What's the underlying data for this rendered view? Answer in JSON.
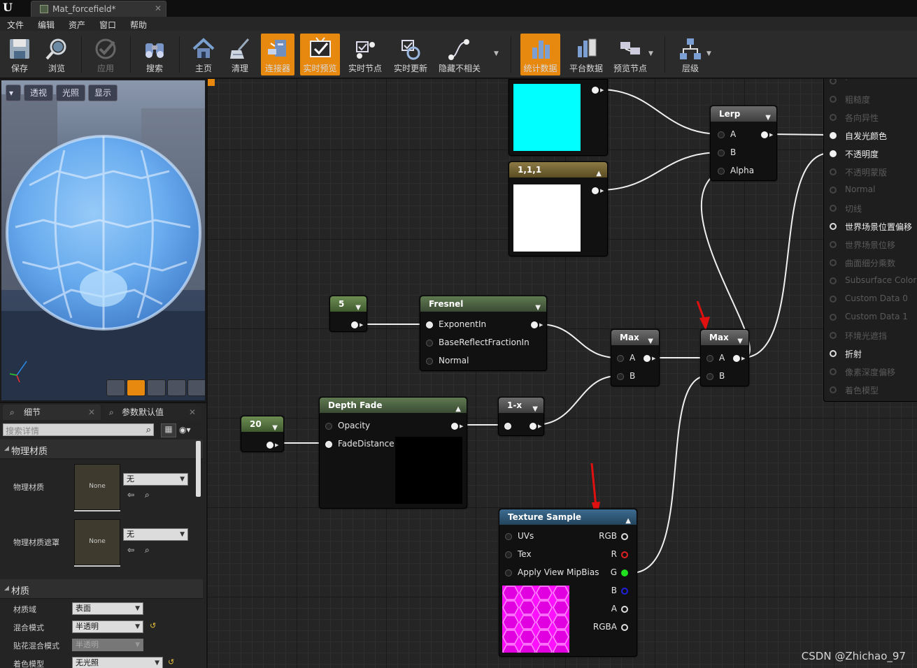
{
  "window": {
    "tab_title": "Mat_forcefield*",
    "tab_close": "✕",
    "logo_glyph": "U"
  },
  "menu": [
    "文件",
    "编辑",
    "资产",
    "窗口",
    "帮助"
  ],
  "toolbar": {
    "items": [
      {
        "label": "保存",
        "icon": "save-icon"
      },
      {
        "label": "浏览",
        "icon": "browse-icon"
      },
      {
        "label": "应用",
        "icon": "apply-icon"
      },
      {
        "label": "搜索",
        "icon": "search-icon"
      },
      {
        "label": "主页",
        "icon": "home-icon"
      },
      {
        "label": "清理",
        "icon": "clean-icon"
      },
      {
        "label": "连接器",
        "icon": "connector-icon"
      },
      {
        "label": "实时预览",
        "icon": "live-preview-icon"
      },
      {
        "label": "实时节点",
        "icon": "live-nodes-icon"
      },
      {
        "label": "实时更新",
        "icon": "live-update-icon"
      },
      {
        "label": "隐藏不相关",
        "icon": "hide-unrelated-icon"
      },
      {
        "label": "统计数据",
        "icon": "stats-icon"
      },
      {
        "label": "平台数据",
        "icon": "platform-stats-icon"
      },
      {
        "label": "预览节点",
        "icon": "preview-node-icon"
      },
      {
        "label": "层级",
        "icon": "hierarchy-icon"
      }
    ],
    "accent": "#e8890f"
  },
  "viewport": {
    "perspective": "透视",
    "lit": "光照",
    "show": "显示"
  },
  "details": {
    "tab_details": "细节",
    "tab_defaults": "参数默认值",
    "search_placeholder": "搜索详情",
    "section_physical": "物理材质",
    "phys_material_label": "物理材质",
    "phys_mask_label": "物理材质遮罩",
    "thumb_none": "None",
    "combo_none": "无",
    "section_material": "材质",
    "domain_label": "材质域",
    "domain_value": "表面",
    "blend_label": "混合模式",
    "blend_value": "半透明",
    "decal_label": "贴花混合模式",
    "decal_value": "半透明",
    "shading_label": "着色模型",
    "shading_value": "无光照"
  },
  "graph": {
    "color_node_label": "1,1,1",
    "const5": "5",
    "const20": "20",
    "fresnel": {
      "title": "Fresnel",
      "pins": [
        "ExponentIn",
        "BaseReflectFractionIn",
        "Normal"
      ]
    },
    "depth_fade": {
      "title": "Depth Fade",
      "pins": [
        "Opacity",
        "FadeDistance"
      ]
    },
    "one_minus": "1-x",
    "max1": {
      "title": "Max",
      "a": "A",
      "b": "B"
    },
    "max2": {
      "title": "Max",
      "a": "A",
      "b": "B"
    },
    "lerp": {
      "title": "Lerp",
      "pins": [
        "A",
        "B",
        "Alpha"
      ]
    },
    "texture": {
      "title": "Texture Sample",
      "inputs": [
        "UVs",
        "Tex",
        "Apply View MipBias"
      ],
      "outputs": [
        "RGB",
        "R",
        "G",
        "B",
        "A",
        "RGBA"
      ]
    },
    "result_pins": [
      {
        "label": "粗糙度",
        "on": false
      },
      {
        "label": "各向异性",
        "on": false
      },
      {
        "label": "自发光颜色",
        "on": true
      },
      {
        "label": "不透明度",
        "on": true
      },
      {
        "label": "不透明蒙版",
        "on": false
      },
      {
        "label": "Normal",
        "on": false
      },
      {
        "label": "切线",
        "on": false
      },
      {
        "label": "世界场景位置偏移",
        "on": true
      },
      {
        "label": "世界场景位移",
        "on": false
      },
      {
        "label": "曲面细分乘数",
        "on": false
      },
      {
        "label": "Subsurface Color",
        "on": false
      },
      {
        "label": "Custom Data 0",
        "on": false
      },
      {
        "label": "Custom Data 1",
        "on": false
      },
      {
        "label": "环境光遮挡",
        "on": false
      },
      {
        "label": "折射",
        "on": true
      },
      {
        "label": "像素深度偏移",
        "on": false
      },
      {
        "label": "着色模型",
        "on": false
      }
    ],
    "colors": {
      "cyan": "#00ffff",
      "white": "#ffffff",
      "magenta": "#ff00ff",
      "wire": "#f0f0f0"
    }
  },
  "watermark": "CSDN @Zhichao_97"
}
